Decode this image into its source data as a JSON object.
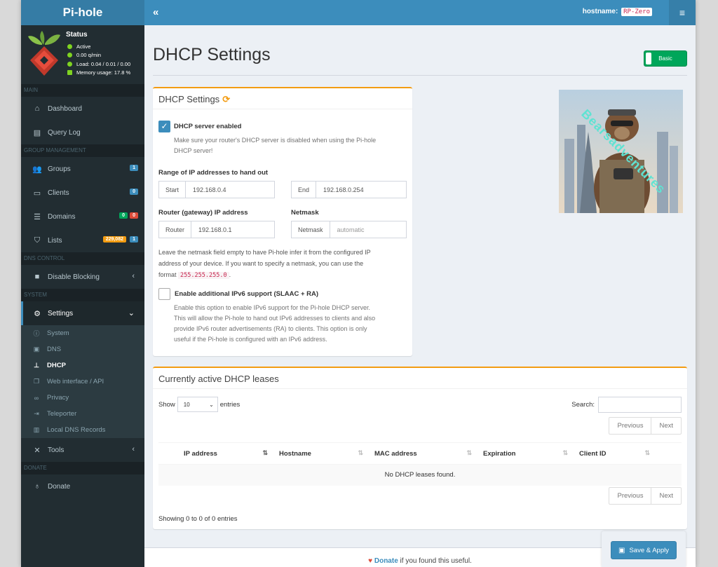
{
  "app": {
    "logo": "Pi-hole",
    "hostname_label": "hostname:",
    "hostname": "RP-Zero",
    "collapse_glyph": "«",
    "menu_glyph": "≡"
  },
  "sidebar": {
    "status": {
      "title": "Status",
      "active": "Active",
      "rate": "0.00 q/min",
      "load": "Load: 0.04 / 0.01 / 0.00",
      "memory": "Memory usage: 17.8 %"
    },
    "sections": {
      "main": "MAIN",
      "group": "GROUP MANAGEMENT",
      "dns": "DNS CONTROL",
      "system": "SYSTEM",
      "donate": "DONATE"
    },
    "items": {
      "dashboard": "Dashboard",
      "query_log": "Query Log",
      "groups": "Groups",
      "groups_badge": "1",
      "clients": "Clients",
      "clients_badge": "0",
      "domains": "Domains",
      "domains_badge_green": "0",
      "domains_badge_red": "0",
      "lists": "Lists",
      "lists_badge_orange": "229,082",
      "lists_badge_blue": "1",
      "disable_blocking": "Disable Blocking",
      "settings": "Settings",
      "tools": "Tools",
      "donate": "Donate"
    },
    "settings_sub": {
      "system": "System",
      "dns": "DNS",
      "dhcp": "DHCP",
      "web": "Web interface / API",
      "privacy": "Privacy",
      "teleporter": "Teleporter",
      "local_dns": "Local DNS Records"
    }
  },
  "page": {
    "title": "DHCP Settings",
    "mode_toggle": "Basic"
  },
  "dhcp_box": {
    "title": "DHCP Settings",
    "server_enabled_label": "DHCP server enabled",
    "server_enabled_help_1": "Make sure your router's DHCP server is disabled when using the Pi-hole",
    "server_enabled_help_2": "DHCP server!",
    "range_label": "Range of IP addresses to hand out",
    "start_addon": "Start",
    "start_value": "192.168.0.4",
    "end_addon": "End",
    "end_value": "192.168.0.254",
    "router_label": "Router (gateway) IP address",
    "router_addon": "Router",
    "router_value": "192.168.0.1",
    "netmask_label": "Netmask",
    "netmask_addon": "Netmask",
    "netmask_placeholder": "automatic",
    "netmask_help_1": "Leave the netmask field empty to have Pi-hole infer it from the configured IP",
    "netmask_help_2": "address of your device. If you want to specify a netmask, you can use the",
    "netmask_help_3a": "format",
    "netmask_help_code": "255.255.255.0",
    "netmask_help_3b": ".",
    "ipv6_label": "Enable additional IPv6 support (SLAAC + RA)",
    "ipv6_help_1": "Enable this option to enable IPv6 support for the Pi-hole DHCP server.",
    "ipv6_help_2": "This will allow the Pi-hole to hand out IPv6 addresses to clients and also",
    "ipv6_help_3": "provide IPv6 router advertisements (RA) to clients. This option is only",
    "ipv6_help_4": "useful if the Pi-hole is configured with an IPv6 address."
  },
  "watermark": "Bearsadventures",
  "leases_box": {
    "title": "Currently active DHCP leases",
    "show_label": "Show",
    "entries_value": "10",
    "entries_label": "entries",
    "search_label": "Search:",
    "previous": "Previous",
    "next": "Next",
    "columns": [
      "IP address",
      "Hostname",
      "MAC address",
      "Expiration",
      "Client ID"
    ],
    "empty": "No DHCP leases found.",
    "showing": "Showing 0 to 0 of 0 entries"
  },
  "footer": {
    "donate_link": "Donate",
    "donate_rest": " if you found this useful."
  },
  "save_button": "Save & Apply",
  "colors": {
    "header": "#3c8dbc",
    "sidebar": "#222d32",
    "warning_border": "#f39c12",
    "success": "#00a65a"
  }
}
